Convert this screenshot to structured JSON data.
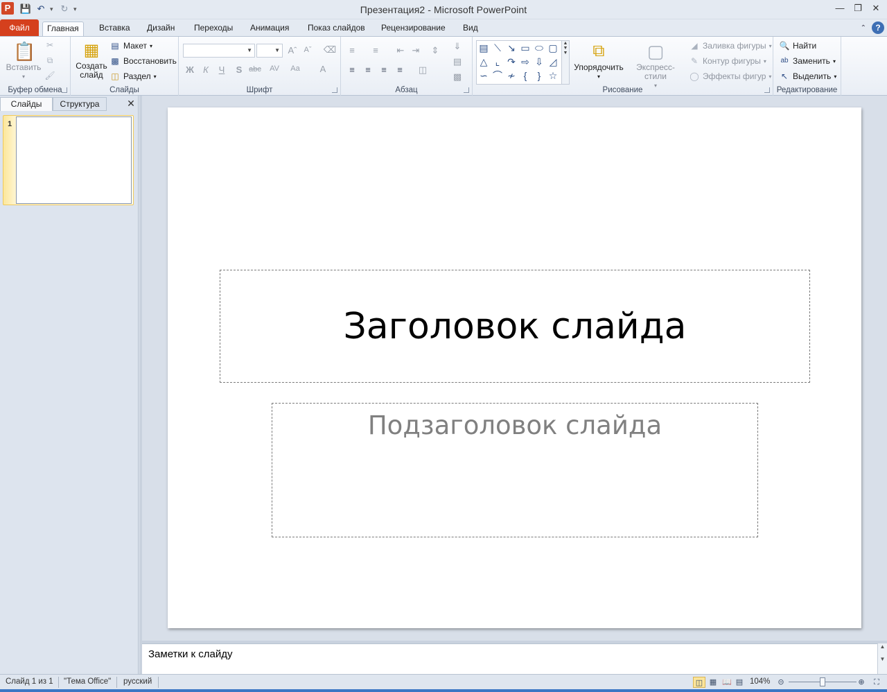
{
  "window": {
    "title": "Презентация2  -  Microsoft PowerPoint",
    "app_icon_letter": "P"
  },
  "tabs": {
    "file": "Файл",
    "items": [
      "Главная",
      "Вставка",
      "Дизайн",
      "Переходы",
      "Анимация",
      "Показ слайдов",
      "Рецензирование",
      "Вид"
    ],
    "active": "Главная"
  },
  "ribbon": {
    "clipboard": {
      "label": "Буфер обмена",
      "paste": "Вставить"
    },
    "slides": {
      "label": "Слайды",
      "new_slide_line1": "Создать",
      "new_slide_line2": "слайд",
      "layout": "Макет",
      "reset": "Восстановить",
      "section": "Раздел"
    },
    "font": {
      "label": "Шрифт",
      "name_value": "",
      "size_value": ""
    },
    "paragraph": {
      "label": "Абзац"
    },
    "drawing": {
      "label": "Рисование",
      "arrange": "Упорядочить",
      "quick_styles": "Экспресс-стили",
      "shape_fill": "Заливка фигуры",
      "shape_outline": "Контур фигуры",
      "shape_effects": "Эффекты фигур"
    },
    "editing": {
      "label": "Редактирование",
      "find": "Найти",
      "replace": "Заменить",
      "select": "Выделить"
    }
  },
  "left_pane": {
    "tab_slides": "Слайды",
    "tab_outline": "Структура",
    "slide_number": "1"
  },
  "slide": {
    "title_placeholder": "Заголовок слайда",
    "subtitle_placeholder": "Подзаголовок слайда"
  },
  "notes": {
    "placeholder": "Заметки к слайду"
  },
  "status": {
    "slide_info": "Слайд 1 из 1",
    "theme": "\"Тема Office\"",
    "language": "русский",
    "zoom": "104%",
    "zoom_fraction": 0.5
  },
  "colors": {
    "file_tab": "#d5401d",
    "selected_thumb": "#fbe59a",
    "taskbar_strip": "#3b76c4"
  }
}
